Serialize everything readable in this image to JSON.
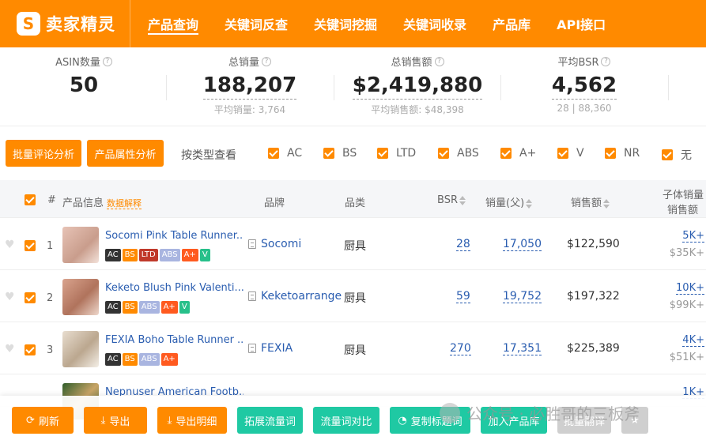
{
  "app": {
    "logo_char": "S",
    "name": "卖家精灵"
  },
  "nav": [
    "产品查询",
    "关键词反查",
    "关键词挖掘",
    "关键词收录",
    "产品库",
    "API接口"
  ],
  "stats": [
    {
      "label": "ASIN数量",
      "value": "50",
      "sub": ""
    },
    {
      "label": "总销量",
      "value": "188,207",
      "sub": "平均销量: 3,764"
    },
    {
      "label": "总销售额",
      "value": "$2,419,880",
      "sub": "平均销售额: $48,398"
    },
    {
      "label": "平均BSR",
      "value": "4,562",
      "sub": "28 | 88,360"
    }
  ],
  "filters": {
    "btn_review": "批量评论分析",
    "btn_attr": "产品属性分析",
    "by_type": "按类型查看",
    "types": [
      "AC",
      "BS",
      "LTD",
      "ABS",
      "A+",
      "V",
      "NR",
      "无"
    ]
  },
  "table": {
    "headers": {
      "num": "#",
      "info": "产品信息",
      "info_link": "数据解释",
      "brand": "品牌",
      "category": "品类",
      "bsr": "BSR",
      "sales": "销量(父)",
      "revenue": "销售额",
      "child_sales": "子体销量",
      "child_revenue": "销售额"
    },
    "rows": [
      {
        "idx": "1",
        "title": "Socomi Pink Table Runner...",
        "tags": [
          "AC",
          "BS",
          "LTD",
          "ABS",
          "A+",
          "V"
        ],
        "brand": "Socomi",
        "category": "厨具",
        "bsr": "28",
        "sales": "17,050",
        "revenue": "$122,590",
        "child_sales": "5K+",
        "child_revenue": "$35K+"
      },
      {
        "idx": "2",
        "title": "Keketo Blush Pink Valenti...",
        "tags": [
          "AC",
          "BS",
          "ABS",
          "A+",
          "V"
        ],
        "brand": "Keketoarrange",
        "category": "厨具",
        "bsr": "59",
        "sales": "19,752",
        "revenue": "$197,322",
        "child_sales": "10K+",
        "child_revenue": "$99K+"
      },
      {
        "idx": "3",
        "title": "FEXIA Boho Table Runner ...",
        "tags": [
          "AC",
          "BS",
          "ABS",
          "A+"
        ],
        "brand": "FEXIA",
        "category": "厨具",
        "bsr": "270",
        "sales": "17,351",
        "revenue": "$225,389",
        "child_sales": "4K+",
        "child_revenue": "$51K+"
      },
      {
        "idx": "",
        "title": "Nepnuser American Footb...",
        "tags": [],
        "brand": "",
        "category": "",
        "bsr": "",
        "sales": "",
        "revenue": "",
        "child_sales": "1K+",
        "child_revenue": ""
      }
    ]
  },
  "toolbar": {
    "refresh": "刷新",
    "export": "导出",
    "export_detail": "导出明细",
    "expand_keywords": "拓展流量词",
    "compare_keywords": "流量词对比",
    "copy_title_keywords": "复制标题词",
    "add_library": "加入产品库",
    "batch_flip": "批量翻译"
  },
  "watermark": "公众号 · 必胜哥的三板斧",
  "colors": {
    "brand": "#ff8a00",
    "teal": "#1fc9a3",
    "link": "#2a5db0"
  }
}
